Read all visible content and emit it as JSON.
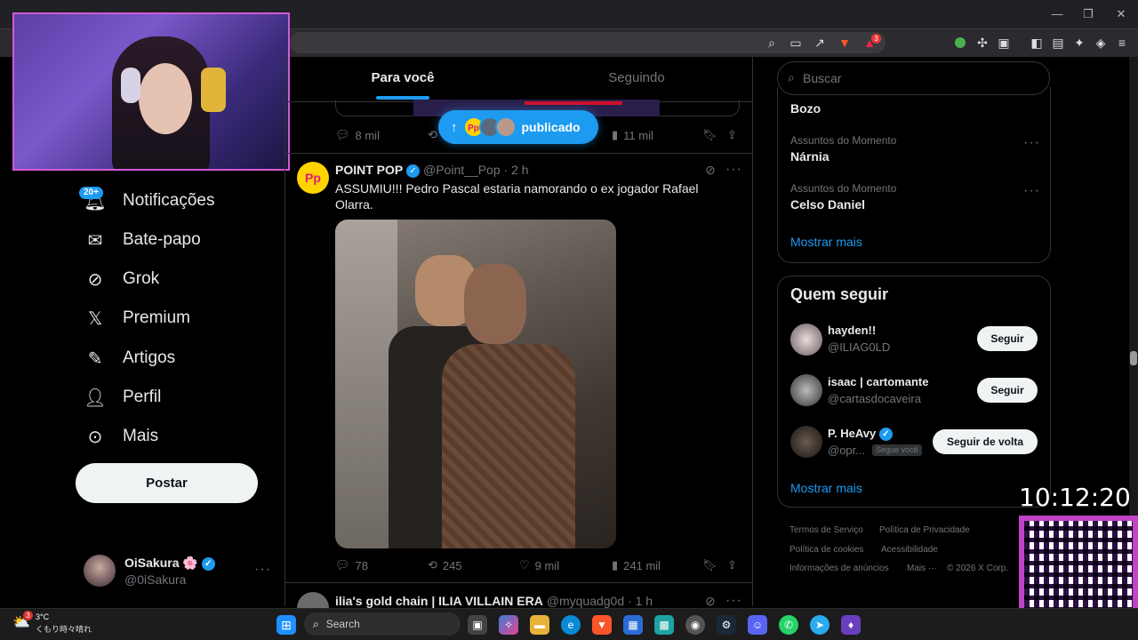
{
  "browser": {
    "notif_count": "3"
  },
  "timeline": {
    "tabs": [
      "Para você",
      "Seguindo"
    ],
    "new_posts_pill": "publicado",
    "prev_post": {
      "replies": "8 mil",
      "views": "11 mil"
    },
    "post": {
      "author": "POINT POP",
      "handle": "@Point__Pop",
      "time": "· 2 h",
      "avatar_text": "Pp",
      "text": "ASSUMIU!!! Pedro Pascal estaria namorando o ex jogador Rafael Olarra.",
      "text2": ".",
      "replies": "78",
      "reposts": "245",
      "likes": "9 mil",
      "views": "241 mil"
    },
    "next_post": {
      "author": "ilia's gold chain | ILIA VILLAIN ERA",
      "handle": "@myquadg0d",
      "time": "· 1 h"
    }
  },
  "sidebar": {
    "notif_badge": "20+",
    "items": [
      {
        "label": "Notificações",
        "icon": "bell-icon"
      },
      {
        "label": "Bate-papo",
        "icon": "mail-icon"
      },
      {
        "label": "Grok",
        "icon": "grok-icon"
      },
      {
        "label": "Premium",
        "icon": "x-logo-icon"
      },
      {
        "label": "Artigos",
        "icon": "article-icon"
      },
      {
        "label": "Perfil",
        "icon": "person-icon"
      },
      {
        "label": "Mais",
        "icon": "more-circle-icon"
      }
    ],
    "post_label": "Postar",
    "account": {
      "name": "OiSakura",
      "handle": "@0iSakura",
      "flower": "🌸"
    }
  },
  "right": {
    "search_placeholder": "Buscar",
    "trends": [
      {
        "category": "",
        "name": "Bozo"
      },
      {
        "category": "Assuntos do Momento",
        "name": "Nárnia"
      },
      {
        "category": "Assuntos do Momento",
        "name": "Celso Daniel"
      }
    ],
    "show_more": "Mostrar mais",
    "who_to_follow": {
      "title": "Quem seguir",
      "users": [
        {
          "name": "hayden!!",
          "handle": "@ILIAG0LD",
          "button": "Seguir",
          "follows_you": ""
        },
        {
          "name": "isaac | cartomante",
          "handle": "@cartasdocaveira",
          "button": "Seguir",
          "follows_you": ""
        },
        {
          "name": "P. HeAvy",
          "handle": "@opr...",
          "button": "Seguir de volta",
          "follows_you": "Segue você"
        }
      ],
      "show_more": "Mostrar mais"
    },
    "footer": {
      "terms": "Termos de Serviço",
      "privacy": "Política de Privacidade",
      "cookies": "Política de cookies",
      "accessibility": "Acessibilidade",
      "ads": "Informações de anúncios",
      "more": "Mais ···",
      "copyright": "© 2026 X Corp."
    }
  },
  "overlay": {
    "clock": "10:12:20"
  },
  "taskbar": {
    "weather_temp": "3°C",
    "weather_desc": "くもり時々晴れ",
    "weather_badge": "3",
    "search_label": "Search"
  },
  "colors": {
    "accent": "#1d9bf0",
    "stream_border": "#d259d6",
    "background": "#000000"
  }
}
